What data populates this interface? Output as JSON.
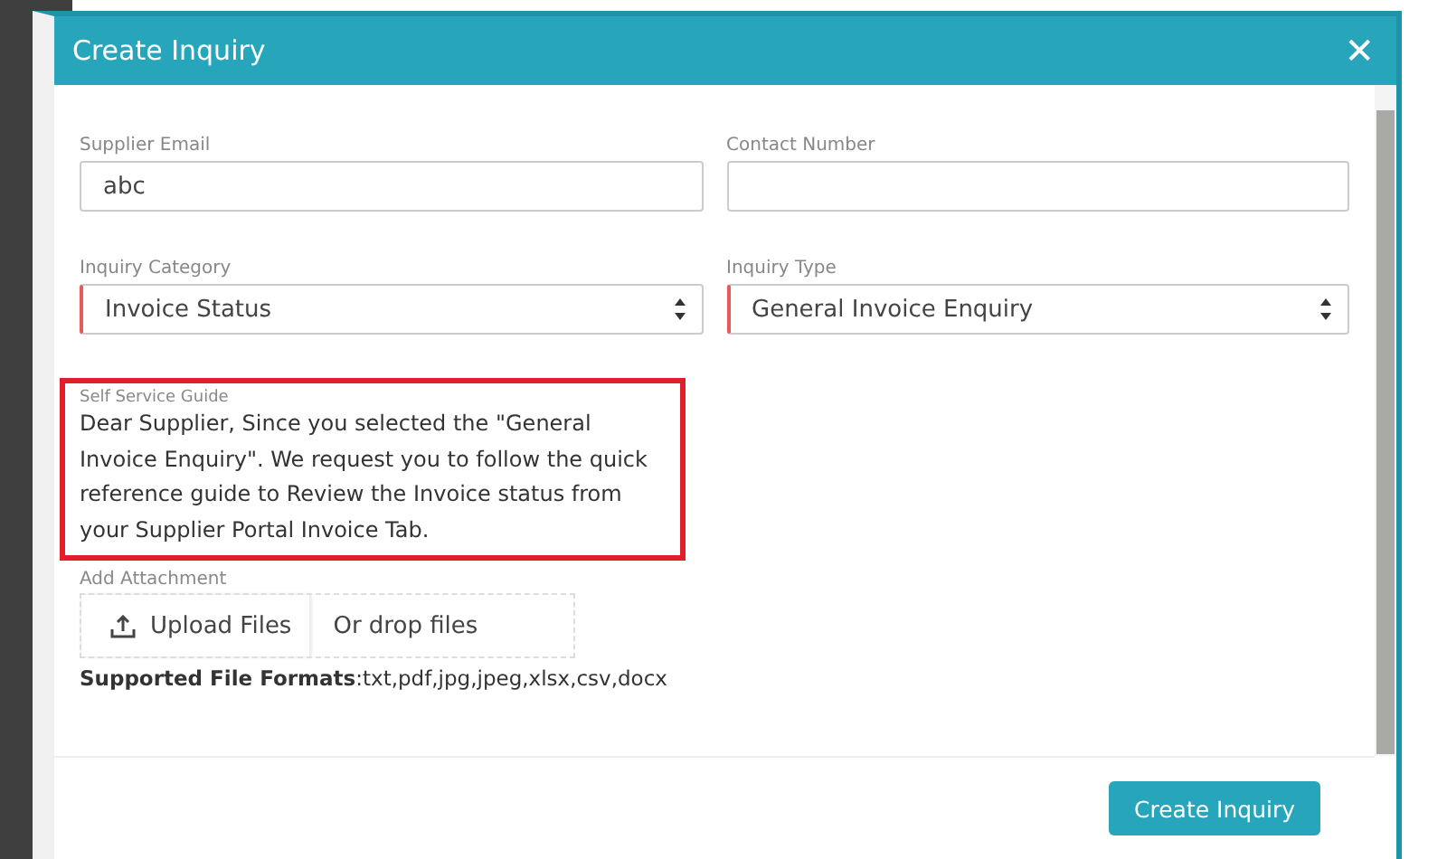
{
  "dialog": {
    "title": "Create Inquiry",
    "close_icon": "✕"
  },
  "fields": [
    {
      "kind": "input",
      "label": "Supplier Email",
      "value": "abc"
    },
    {
      "kind": "input",
      "label": "Contact Number"
    },
    {
      "kind": "select",
      "label": "Inquiry Category",
      "value": "Invoice Status",
      "required": true
    },
    {
      "kind": "select",
      "label": "Inquiry Type",
      "value": "General Invoice Enquiry",
      "required": true
    }
  ],
  "guide": {
    "label": "Self Service Guide",
    "text": "Dear Supplier, Since you selected the \"General Invoice Enquiry\". We request you to follow the quick reference guide to Review the Invoice status from your Supplier Portal Invoice Tab.",
    "highlighted": true
  },
  "attachment": {
    "label": "Add Attachment",
    "upload_button": "Upload Files",
    "drop_text": "Or drop files",
    "formats": "**Supported File Formats**:txt,pdf,jpg,jpeg,xlsx,csv,docx"
  },
  "footer": {
    "button": "Create Inquiry"
  }
}
